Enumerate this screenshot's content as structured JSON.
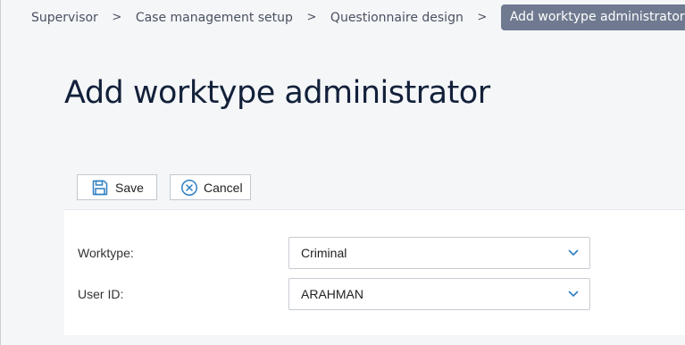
{
  "breadcrumb": {
    "items": [
      "Supervisor",
      "Case management setup",
      "Questionnaire design"
    ],
    "current": "Add worktype administrator",
    "separator": ">"
  },
  "page": {
    "title": "Add worktype administrator"
  },
  "toolbar": {
    "save_label": "Save",
    "cancel_label": "Cancel",
    "save_icon": "floppy-disk-icon",
    "cancel_icon": "x-circle-icon",
    "icon_color": "#2f7fc1"
  },
  "form": {
    "worktype": {
      "label": "Worktype:",
      "value": "Criminal"
    },
    "user_id": {
      "label": "User ID:",
      "value": "ARAHMAN"
    }
  },
  "colors": {
    "accent": "#2f7fc1",
    "breadcrumb_current_bg": "#6f7a90",
    "title": "#13203a",
    "background": "#f4f6f8"
  }
}
